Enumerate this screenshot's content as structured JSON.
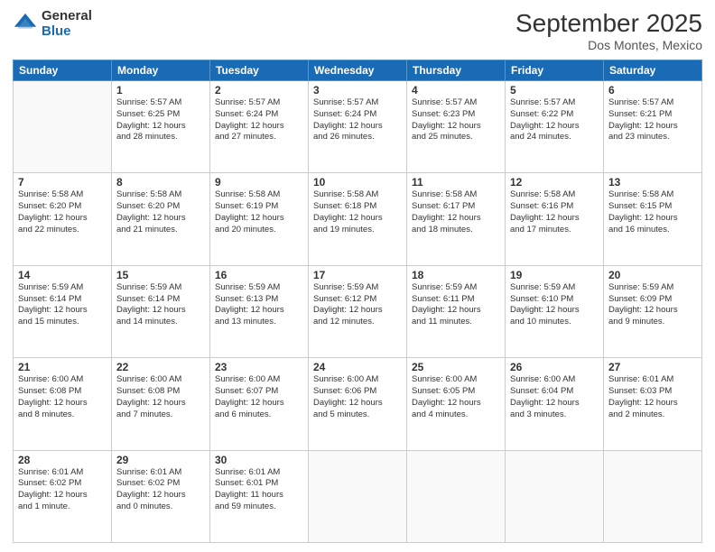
{
  "header": {
    "logo_general": "General",
    "logo_blue": "Blue",
    "month_title": "September 2025",
    "location": "Dos Montes, Mexico"
  },
  "weekdays": [
    "Sunday",
    "Monday",
    "Tuesday",
    "Wednesday",
    "Thursday",
    "Friday",
    "Saturday"
  ],
  "weeks": [
    [
      {
        "day": "",
        "info": ""
      },
      {
        "day": "1",
        "info": "Sunrise: 5:57 AM\nSunset: 6:25 PM\nDaylight: 12 hours\nand 28 minutes."
      },
      {
        "day": "2",
        "info": "Sunrise: 5:57 AM\nSunset: 6:24 PM\nDaylight: 12 hours\nand 27 minutes."
      },
      {
        "day": "3",
        "info": "Sunrise: 5:57 AM\nSunset: 6:24 PM\nDaylight: 12 hours\nand 26 minutes."
      },
      {
        "day": "4",
        "info": "Sunrise: 5:57 AM\nSunset: 6:23 PM\nDaylight: 12 hours\nand 25 minutes."
      },
      {
        "day": "5",
        "info": "Sunrise: 5:57 AM\nSunset: 6:22 PM\nDaylight: 12 hours\nand 24 minutes."
      },
      {
        "day": "6",
        "info": "Sunrise: 5:57 AM\nSunset: 6:21 PM\nDaylight: 12 hours\nand 23 minutes."
      }
    ],
    [
      {
        "day": "7",
        "info": "Sunrise: 5:58 AM\nSunset: 6:20 PM\nDaylight: 12 hours\nand 22 minutes."
      },
      {
        "day": "8",
        "info": "Sunrise: 5:58 AM\nSunset: 6:20 PM\nDaylight: 12 hours\nand 21 minutes."
      },
      {
        "day": "9",
        "info": "Sunrise: 5:58 AM\nSunset: 6:19 PM\nDaylight: 12 hours\nand 20 minutes."
      },
      {
        "day": "10",
        "info": "Sunrise: 5:58 AM\nSunset: 6:18 PM\nDaylight: 12 hours\nand 19 minutes."
      },
      {
        "day": "11",
        "info": "Sunrise: 5:58 AM\nSunset: 6:17 PM\nDaylight: 12 hours\nand 18 minutes."
      },
      {
        "day": "12",
        "info": "Sunrise: 5:58 AM\nSunset: 6:16 PM\nDaylight: 12 hours\nand 17 minutes."
      },
      {
        "day": "13",
        "info": "Sunrise: 5:58 AM\nSunset: 6:15 PM\nDaylight: 12 hours\nand 16 minutes."
      }
    ],
    [
      {
        "day": "14",
        "info": "Sunrise: 5:59 AM\nSunset: 6:14 PM\nDaylight: 12 hours\nand 15 minutes."
      },
      {
        "day": "15",
        "info": "Sunrise: 5:59 AM\nSunset: 6:14 PM\nDaylight: 12 hours\nand 14 minutes."
      },
      {
        "day": "16",
        "info": "Sunrise: 5:59 AM\nSunset: 6:13 PM\nDaylight: 12 hours\nand 13 minutes."
      },
      {
        "day": "17",
        "info": "Sunrise: 5:59 AM\nSunset: 6:12 PM\nDaylight: 12 hours\nand 12 minutes."
      },
      {
        "day": "18",
        "info": "Sunrise: 5:59 AM\nSunset: 6:11 PM\nDaylight: 12 hours\nand 11 minutes."
      },
      {
        "day": "19",
        "info": "Sunrise: 5:59 AM\nSunset: 6:10 PM\nDaylight: 12 hours\nand 10 minutes."
      },
      {
        "day": "20",
        "info": "Sunrise: 5:59 AM\nSunset: 6:09 PM\nDaylight: 12 hours\nand 9 minutes."
      }
    ],
    [
      {
        "day": "21",
        "info": "Sunrise: 6:00 AM\nSunset: 6:08 PM\nDaylight: 12 hours\nand 8 minutes."
      },
      {
        "day": "22",
        "info": "Sunrise: 6:00 AM\nSunset: 6:08 PM\nDaylight: 12 hours\nand 7 minutes."
      },
      {
        "day": "23",
        "info": "Sunrise: 6:00 AM\nSunset: 6:07 PM\nDaylight: 12 hours\nand 6 minutes."
      },
      {
        "day": "24",
        "info": "Sunrise: 6:00 AM\nSunset: 6:06 PM\nDaylight: 12 hours\nand 5 minutes."
      },
      {
        "day": "25",
        "info": "Sunrise: 6:00 AM\nSunset: 6:05 PM\nDaylight: 12 hours\nand 4 minutes."
      },
      {
        "day": "26",
        "info": "Sunrise: 6:00 AM\nSunset: 6:04 PM\nDaylight: 12 hours\nand 3 minutes."
      },
      {
        "day": "27",
        "info": "Sunrise: 6:01 AM\nSunset: 6:03 PM\nDaylight: 12 hours\nand 2 minutes."
      }
    ],
    [
      {
        "day": "28",
        "info": "Sunrise: 6:01 AM\nSunset: 6:02 PM\nDaylight: 12 hours\nand 1 minute."
      },
      {
        "day": "29",
        "info": "Sunrise: 6:01 AM\nSunset: 6:02 PM\nDaylight: 12 hours\nand 0 minutes."
      },
      {
        "day": "30",
        "info": "Sunrise: 6:01 AM\nSunset: 6:01 PM\nDaylight: 11 hours\nand 59 minutes."
      },
      {
        "day": "",
        "info": ""
      },
      {
        "day": "",
        "info": ""
      },
      {
        "day": "",
        "info": ""
      },
      {
        "day": "",
        "info": ""
      }
    ]
  ]
}
